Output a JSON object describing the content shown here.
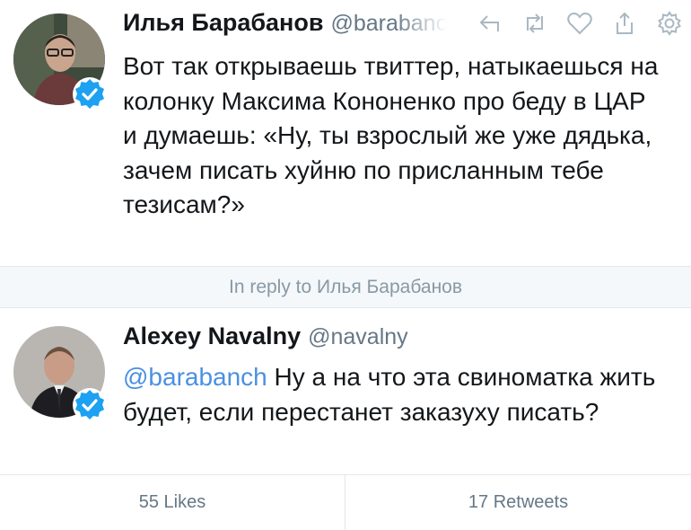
{
  "tweet1": {
    "author_name": "Илья Барабанов",
    "author_handle": "@barabanch",
    "text": "Вот так открываешь твиттер, натыкаешься на колонку Максима Кононенко про беду в ЦАР и думаешь: «Ну, ты взрослый же уже дядька, зачем писать хуйню по присланным тебе тезисам?»",
    "actions": [
      "reply-icon",
      "retweet-icon",
      "like-icon",
      "share-icon",
      "settings-icon"
    ]
  },
  "reply_context": "In reply to Илья Барабанов",
  "tweet2": {
    "author_name": "Alexey Navalny",
    "author_handle": "@navalny",
    "mention": "@barabanch",
    "text": " Ну а на что эта свиноматка жить будет, если перестанет заказуху писать?"
  },
  "stats": {
    "likes": "55 Likes",
    "retweets": "17 Retweets"
  },
  "colors": {
    "mention": "#4a90e2",
    "verified": "#1da1f2",
    "muted": "#657786"
  }
}
